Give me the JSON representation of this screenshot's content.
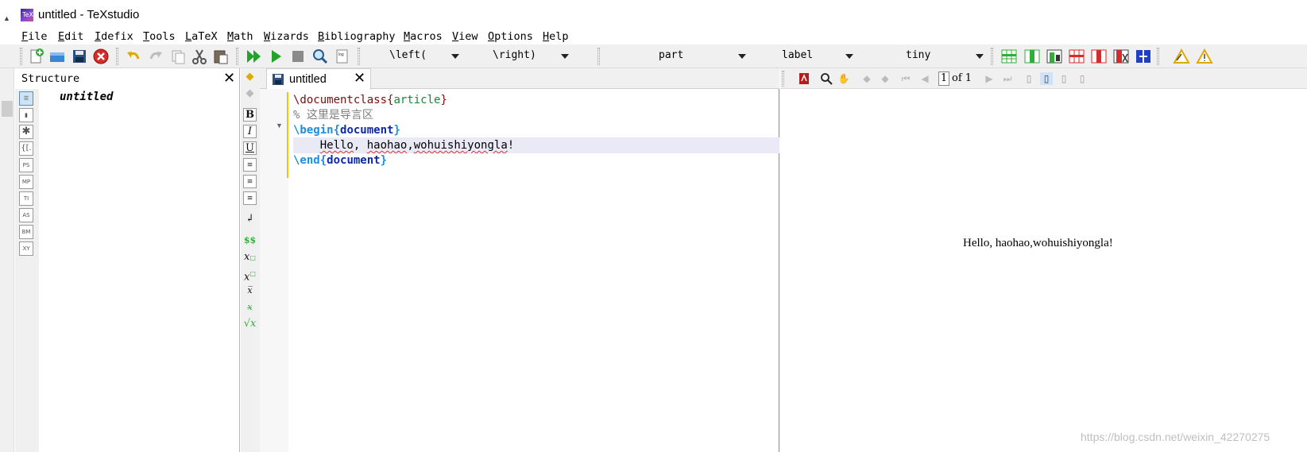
{
  "window": {
    "title": "untitled - TeXstudio",
    "icon": "texstudio-app-icon"
  },
  "menu": [
    "File",
    "Edit",
    "Idefix",
    "Tools",
    "LaTeX",
    "Math",
    "Wizards",
    "Bibliography",
    "Macros",
    "View",
    "Options",
    "Help"
  ],
  "toolbar": {
    "left_delim": "\\left(",
    "right_delim": "\\right)",
    "sectioning": "part",
    "reference": "label",
    "size": "tiny"
  },
  "structure": {
    "title": "Structure",
    "close": "✕",
    "tree_root": "untitled",
    "sidebar_buttons": [
      "structure-view-icon",
      "bookmarks-icon",
      "symbols-icon",
      "math-icon",
      "ps-icon",
      "mp-icon",
      "ti-icon",
      "as-icon",
      "bm-icon",
      "xy-icon"
    ]
  },
  "editor": {
    "tab_label": "untitled",
    "tab_close": "✕",
    "lines": [
      {
        "cmd": "\\documentclass",
        "brace_open": "{",
        "arg": "article",
        "brace_close": "}"
      },
      {
        "comment": "% 这里是导言区"
      },
      {
        "cmd": "\\begin",
        "brace_open": "{",
        "arg": "document",
        "brace_close": "}"
      },
      {
        "indent": "    ",
        "text_a": "Hello",
        "text_b": ", ",
        "text_c": "haohao",
        "text_d": ",",
        "text_e": "wohuishiyongla",
        "text_f": "!"
      },
      {
        "cmd": "\\end",
        "brace_open": "{",
        "arg": "document",
        "brace_close": "}"
      }
    ]
  },
  "pdf": {
    "page_current": "1",
    "page_of": "of 1",
    "content": "Hello, haohao,wohuishiyongla!"
  },
  "watermark": "https://blog.csdn.net/weixin_42270275"
}
